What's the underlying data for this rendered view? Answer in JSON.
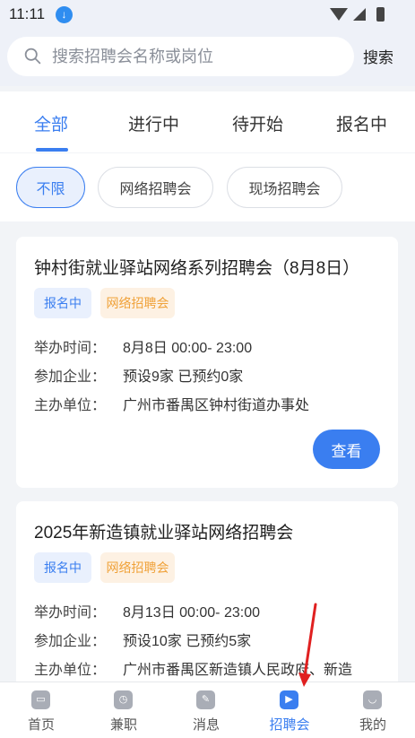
{
  "status_bar": {
    "time": "11:11"
  },
  "search": {
    "placeholder": "搜索招聘会名称或岗位",
    "button_label": "搜索"
  },
  "tabs": [
    {
      "label": "全部",
      "active": true
    },
    {
      "label": "进行中",
      "active": false
    },
    {
      "label": "待开始",
      "active": false
    },
    {
      "label": "报名中",
      "active": false
    }
  ],
  "filters": [
    {
      "label": "不限",
      "active": true
    },
    {
      "label": "网络招聘会",
      "active": false
    },
    {
      "label": "现场招聘会",
      "active": false
    }
  ],
  "cards": [
    {
      "title": "钟村街就业驿站网络系列招聘会（8月8日）",
      "status": "报名中",
      "type": "网络招聘会",
      "rows": [
        {
          "label": "举办时间：",
          "value": "8月8日 00:00- 23:00"
        },
        {
          "label": "参加企业：",
          "value": "预设9家 已预约0家"
        },
        {
          "label": "主办单位：",
          "value": "广州市番禺区钟村街道办事处"
        }
      ],
      "button_label": "查看"
    },
    {
      "title": "2025年新造镇就业驿站网络招聘会",
      "status": "报名中",
      "type": "网络招聘会",
      "rows": [
        {
          "label": "举办时间：",
          "value": "8月13日 00:00- 23:00"
        },
        {
          "label": "参加企业：",
          "value": "预设10家 已预约5家"
        },
        {
          "label": "主办单位：",
          "value": "广州市番禺区新造镇人民政府、新造"
        }
      ]
    }
  ],
  "bottom_nav": [
    {
      "label": "首页",
      "icon": "home-icon",
      "active": false
    },
    {
      "label": "兼职",
      "icon": "clock-icon",
      "active": false
    },
    {
      "label": "消息",
      "icon": "message-icon",
      "active": false
    },
    {
      "label": "招聘会",
      "icon": "job-fair-icon",
      "active": true
    },
    {
      "label": "我的",
      "icon": "profile-icon",
      "active": false
    }
  ],
  "colors": {
    "accent": "#3a7ef0",
    "badge_orange": "#f0a23a",
    "annotation_arrow": "#e02020"
  }
}
